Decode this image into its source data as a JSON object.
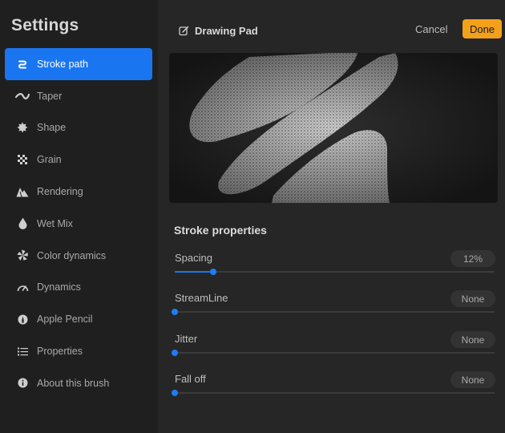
{
  "sidebar": {
    "title": "Settings",
    "items": [
      {
        "label": "Stroke path",
        "icon": "stroke-path-icon",
        "active": true
      },
      {
        "label": "Taper",
        "icon": "taper-icon"
      },
      {
        "label": "Shape",
        "icon": "shape-icon"
      },
      {
        "label": "Grain",
        "icon": "grain-icon"
      },
      {
        "label": "Rendering",
        "icon": "rendering-icon"
      },
      {
        "label": "Wet Mix",
        "icon": "wet-mix-icon"
      },
      {
        "label": "Color dynamics",
        "icon": "color-dynamics-icon"
      },
      {
        "label": "Dynamics",
        "icon": "dynamics-icon"
      },
      {
        "label": "Apple Pencil",
        "icon": "apple-pencil-icon"
      },
      {
        "label": "Properties",
        "icon": "properties-icon"
      },
      {
        "label": "About this brush",
        "icon": "info-icon"
      }
    ]
  },
  "header": {
    "title": "Drawing Pad",
    "cancel_label": "Cancel",
    "done_label": "Done"
  },
  "section": {
    "title": "Stroke properties"
  },
  "properties": [
    {
      "label": "Spacing",
      "value": "12%",
      "level": 0.12
    },
    {
      "label": "StreamLine",
      "value": "None",
      "level": 0
    },
    {
      "label": "Jitter",
      "value": "None",
      "level": 0
    },
    {
      "label": "Fall off",
      "value": "None",
      "level": 0
    }
  ],
  "colors": {
    "accent": "#1976f0",
    "done": "#f3a01b",
    "background": "#262626",
    "sidebar": "#1f1f1f"
  }
}
